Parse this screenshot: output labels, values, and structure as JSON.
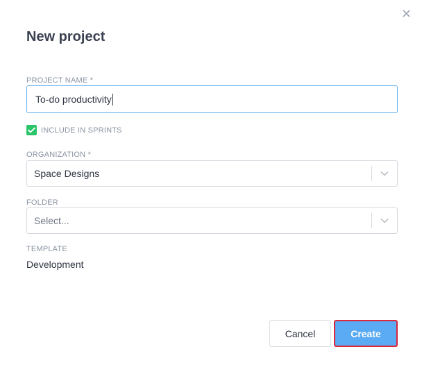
{
  "dialog": {
    "title": "New project",
    "close_icon": "close-icon"
  },
  "form": {
    "project_name": {
      "label": "PROJECT NAME *",
      "value": "To-do productivity"
    },
    "include_in_sprints": {
      "label": "INCLUDE IN SPRINTS",
      "checked": true
    },
    "organization": {
      "label": "ORGANIZATION *",
      "value": "Space Designs"
    },
    "folder": {
      "label": "FOLDER",
      "placeholder": "Select..."
    },
    "template": {
      "label": "TEMPLATE",
      "value": "Development"
    }
  },
  "actions": {
    "cancel_label": "Cancel",
    "create_label": "Create"
  },
  "colors": {
    "accent": "#5aaaf4",
    "checkbox": "#2cc46b",
    "highlight_border": "#d9283a"
  }
}
